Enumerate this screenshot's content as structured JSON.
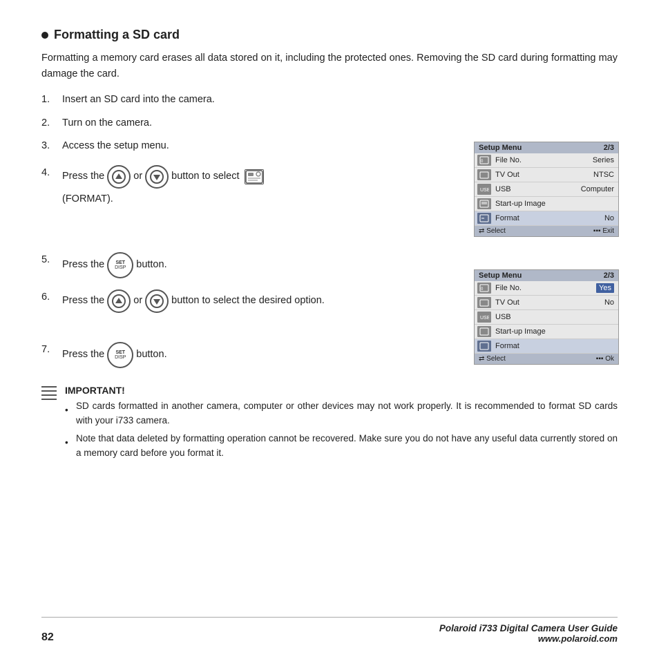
{
  "title": "Formatting a SD card",
  "intro": "Formatting a memory card erases all data stored on it, including the protected ones. Removing the SD card during formatting may damage the card.",
  "steps": [
    {
      "num": "1.",
      "text": "Insert an SD card into the camera."
    },
    {
      "num": "2.",
      "text": "Turn on the camera."
    },
    {
      "num": "3.",
      "text": "Access the setup menu."
    },
    {
      "num": "4.",
      "text_before": "Press the",
      "text_middle": "or",
      "text_after": "button to select",
      "icon_label": "FORMAT",
      "note": "(FORMAT)."
    },
    {
      "num": "5.",
      "text_before": "Press the",
      "text_after": "button."
    },
    {
      "num": "6.",
      "text_before": "Press the",
      "text_middle": "or",
      "text_after": "button to select the desired option."
    },
    {
      "num": "7.",
      "text_before": "Press the",
      "text_after": "button."
    }
  ],
  "menu1": {
    "title": "Setup Menu",
    "page": "2/3",
    "rows": [
      {
        "label": "File No.",
        "value": "Series",
        "highlighted": false
      },
      {
        "label": "TV Out",
        "value": "NTSC",
        "highlighted": false
      },
      {
        "label": "USB",
        "value": "Computer",
        "highlighted": false
      },
      {
        "label": "Start-up Image",
        "value": "",
        "highlighted": false
      },
      {
        "label": "Format",
        "value": "No",
        "highlighted": true
      }
    ],
    "footer_left": "Select",
    "footer_right": "Exit"
  },
  "menu2": {
    "title": "Setup Menu",
    "page": "2/3",
    "rows": [
      {
        "label": "File No.",
        "value": "Yes",
        "highlighted_val": true
      },
      {
        "label": "TV Out",
        "value": "No",
        "highlighted_val": false
      },
      {
        "label": "USB",
        "value": "",
        "highlighted_val": false
      },
      {
        "label": "Start-up Image",
        "value": "",
        "highlighted_val": false
      },
      {
        "label": "Format",
        "value": "",
        "highlighted_val": false
      }
    ],
    "footer_left": "Select",
    "footer_right": "Ok"
  },
  "important": {
    "title": "IMPORTANT!",
    "bullets": [
      "SD cards formatted in another camera, computer or other devices may not work properly. It is recommended to format SD cards with your i733 camera.",
      "Note that data deleted by formatting operation cannot be recovered. Make sure you do not have any useful data currently stored on a memory card before you format it."
    ]
  },
  "footer": {
    "page_num": "82",
    "brand_line1": "Polaroid i733 Digital Camera User Guide",
    "brand_line2": "www.polaroid.com"
  }
}
